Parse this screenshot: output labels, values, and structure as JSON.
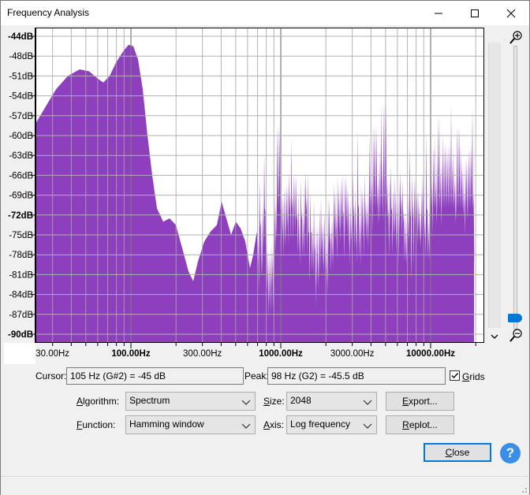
{
  "window": {
    "title": "Frequency Analysis"
  },
  "plot": {
    "fill_color": "#8e3fbd",
    "y_ticks": [
      "-44dB",
      "-48dB",
      "-51dB",
      "-54dB",
      "-57dB",
      "-60dB",
      "-63dB",
      "-66dB",
      "-69dB",
      "-72dB",
      "-75dB",
      "-78dB",
      "-81dB",
      "-84dB",
      "-87dB",
      "-90dB"
    ],
    "x_ticks": [
      "30.00Hz",
      "100.00Hz",
      "300.00Hz",
      "1000.00Hz",
      "3000.00Hz",
      "10000.00Hz"
    ]
  },
  "readout": {
    "cursor_label": "Cursor:",
    "cursor_value": "105 Hz (G#2) = -45 dB",
    "peak_label": "Peak:",
    "peak_value": "98 Hz (G2) = -45.5 dB",
    "grids_label": "Grids",
    "grids_checked": true
  },
  "controls": {
    "algorithm_label": "Algorithm:",
    "algorithm_value": "Spectrum",
    "size_label": "Size:",
    "size_value": "2048",
    "function_label": "Function:",
    "function_value": "Hamming window",
    "axis_label": "Axis:",
    "axis_value": "Log frequency",
    "export_label": "Export...",
    "replot_label": "Replot...",
    "close_label": "Close",
    "help_label": "?"
  }
}
